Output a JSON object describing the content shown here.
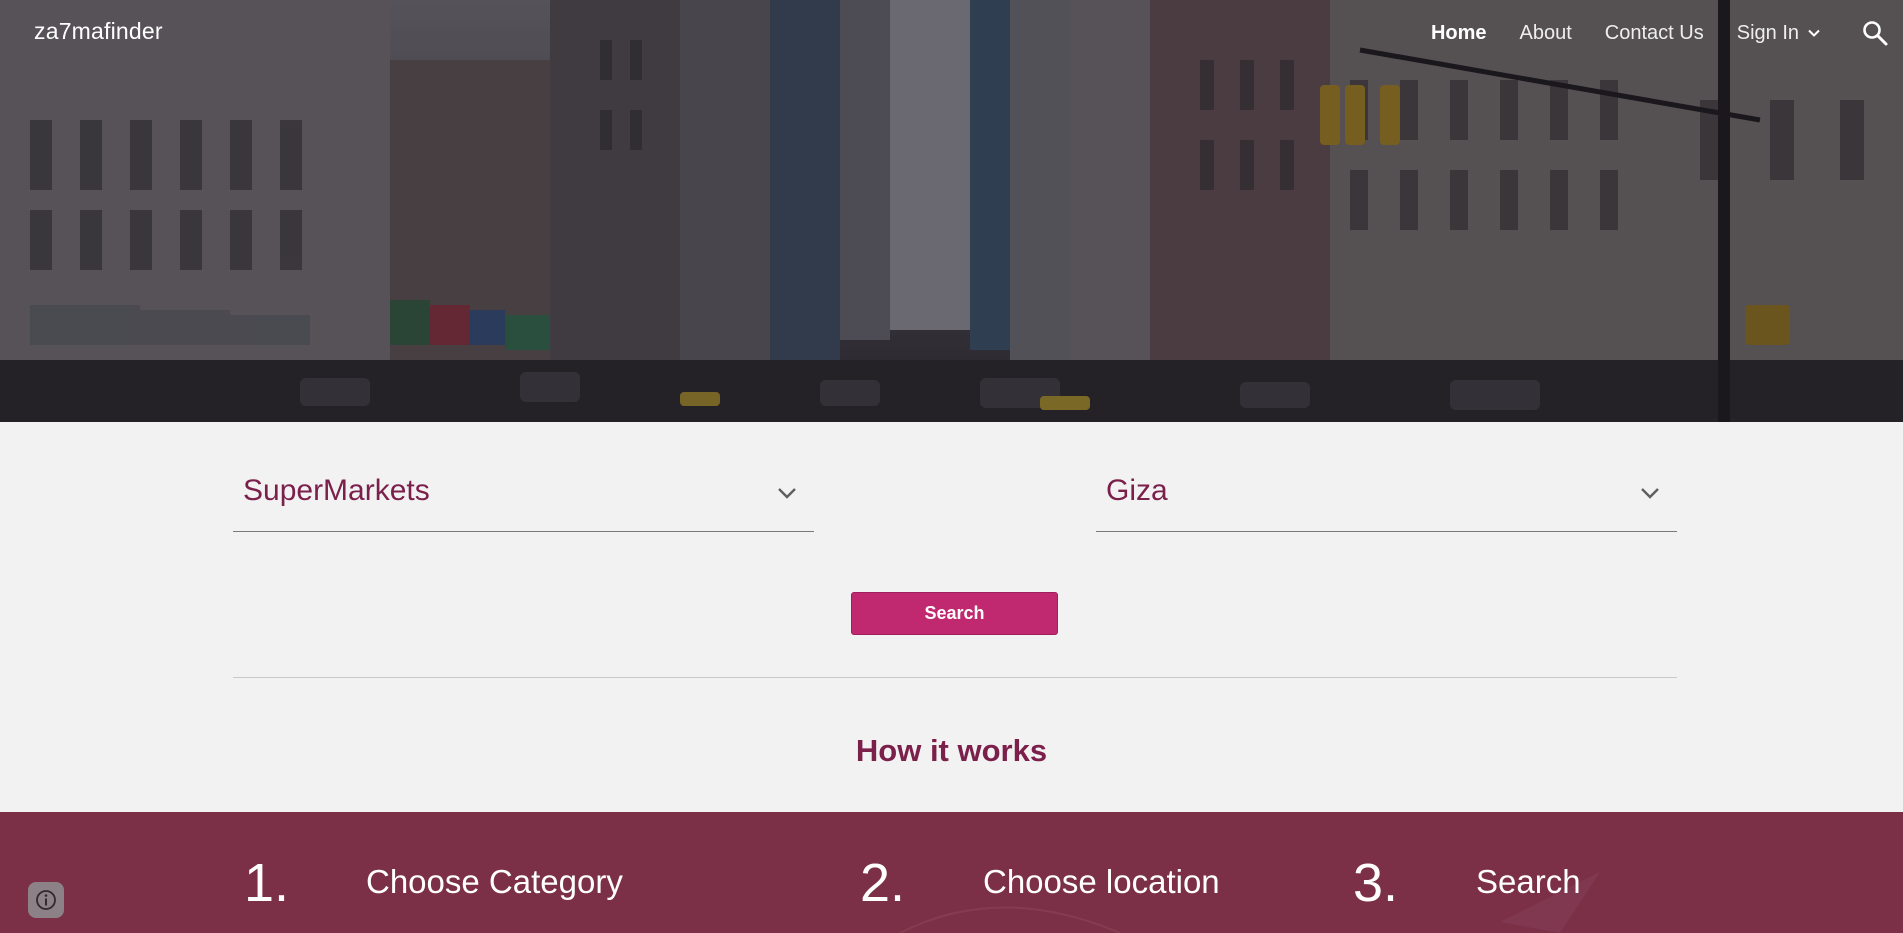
{
  "site": {
    "title": "za7mafinder"
  },
  "nav": {
    "items": [
      {
        "label": "Home",
        "active": true
      },
      {
        "label": "About"
      },
      {
        "label": "Contact Us"
      }
    ],
    "signin_label": "Sign In"
  },
  "search": {
    "category_value": "SuperMarkets",
    "location_value": "Giza",
    "button_label": "Search"
  },
  "how_it_works": {
    "title": "How it works",
    "steps": [
      {
        "number": "1.",
        "label": "Choose Category"
      },
      {
        "number": "2.",
        "label": "Choose location"
      },
      {
        "number": "3.",
        "label": "Search"
      }
    ]
  },
  "colors": {
    "accent": "#c0296f",
    "heading": "#7b1f4b",
    "band": "#7b3047",
    "page_bg": "#f2f2f2"
  },
  "icons": [
    "search-icon",
    "chevron-down-icon",
    "info-icon"
  ]
}
